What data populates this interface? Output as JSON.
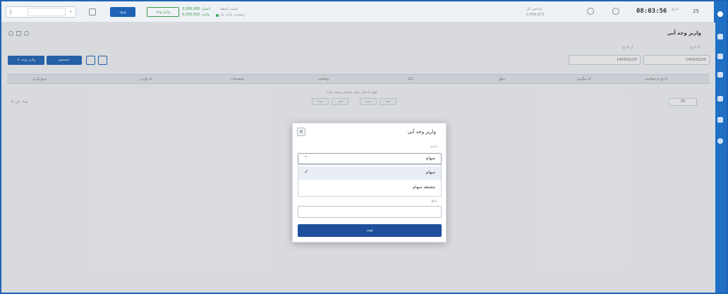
{
  "topbar": {
    "user_chip": "",
    "btn_login": "ورود",
    "btn_deposit": "واریز وجه",
    "credit_line1": "اعتبار: 3,000,000",
    "credit_line2": "مانده: 5,000,000",
    "status_line1": "قیمت لحظه",
    "status_line2": "وضعیت بازار: باز",
    "index_label": "شاخص کل",
    "index_value": "2,456,870",
    "clock": "08:03:56",
    "date_label": "تاریخ",
    "date_value": "25"
  },
  "page": {
    "title": "واریز وجه آنی",
    "from_label": "از تاریخ",
    "to_label": "تا تاریخ",
    "from_date": "1404/02/15",
    "to_date": "1404/02/20",
    "new_deposit_btn": "+ واریز وجه",
    "search_btn": "جستجو",
    "columns": [
      "تاریخ درخواست",
      "کد پیگیری",
      "مبلغ",
      "بانک",
      "وضعیت",
      "توضیحات",
      "کد واریز",
      "منبع واریز"
    ],
    "empty_message": "هیچ داده‌ای برای نمایش وجود ندارد",
    "pager": [
      "ابتدا",
      "قبلی",
      "بعدی",
      "انتها"
    ],
    "rows_per_page": "20",
    "total_label": "تعداد کل: 0"
  },
  "modal": {
    "title": "واریز وجه آنی",
    "source_label": "دامنه",
    "selected_value": "سهام",
    "options": [
      {
        "label": "سهام",
        "selected": true
      },
      {
        "label": "مشتقه سهام",
        "selected": false
      }
    ],
    "amount_label": "مبلغ",
    "amount_value": "",
    "submit_label": "ثبت"
  },
  "colors": {
    "accent": "#1e63b5",
    "submit": "#1e4f9a",
    "sidebar": "#1f6fc3"
  },
  "icons": [
    "close-icon",
    "chevron-up-icon",
    "check-icon",
    "refresh-icon",
    "settings-icon",
    "cloud-icon",
    "bell-icon"
  ]
}
